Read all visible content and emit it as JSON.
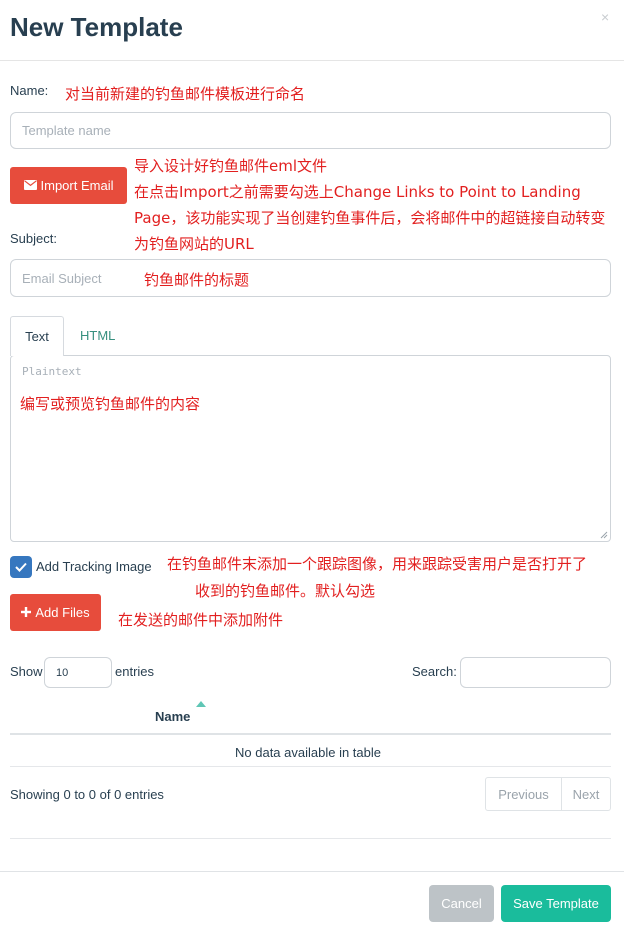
{
  "modal": {
    "title": "New Template",
    "close_glyph": "×"
  },
  "name": {
    "label": "Name:",
    "placeholder": "Template name",
    "annotation": "对当前新建的钓鱼邮件模板进行命名"
  },
  "import": {
    "button_label": "Import Email",
    "icon": "envelope-icon",
    "annotation_lines": [
      "导入设计好钓鱼邮件eml文件",
      "在点击Import之前需要勾选上Change Links to Point to Landing",
      "Page，该功能实现了当创建钓鱼事件后，会将邮件中的超链接自动转变",
      "为钓鱼网站的URL"
    ]
  },
  "subject": {
    "label": "Subject:",
    "placeholder": "Email Subject",
    "annotation": "钓鱼邮件的标题"
  },
  "tabs": [
    {
      "label": "Text",
      "active": true
    },
    {
      "label": "HTML",
      "active": false
    }
  ],
  "body": {
    "placeholder": "Plaintext",
    "annotation": "编写或预览钓鱼邮件的内容"
  },
  "tracking": {
    "label": "Add Tracking Image",
    "checked": true,
    "annotation_lines": [
      "在钓鱼邮件末添加一个跟踪图像，用来跟踪受害用户是否打开了",
      "收到的钓鱼邮件。默认勾选"
    ]
  },
  "files": {
    "button_label": "Add Files",
    "icon": "plus-icon",
    "annotation": "在发送的邮件中添加附件"
  },
  "table": {
    "show_label": "Show",
    "entries_value": "10",
    "entries_label": "entries",
    "search_label": "Search:",
    "column_name": "Name",
    "empty_text": "No data available in table",
    "info": "Showing 0 to 0 of 0 entries",
    "prev_label": "Previous",
    "next_label": "Next"
  },
  "footer": {
    "cancel_label": "Cancel",
    "save_label": "Save Template"
  },
  "colors": {
    "danger": "#e74c3c",
    "primary": "#1abc9c",
    "annotation": "#e21f1f",
    "checkbox": "#3677bf",
    "title": "#283f50"
  }
}
